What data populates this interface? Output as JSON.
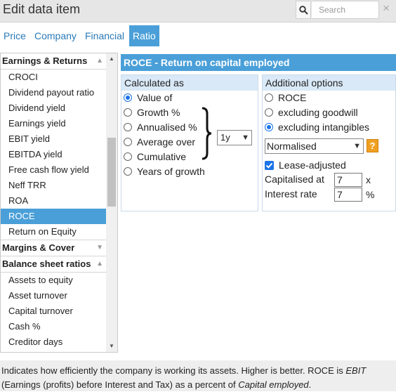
{
  "window": {
    "title": "Edit data item"
  },
  "search": {
    "placeholder": "Search",
    "close": "×"
  },
  "tabs": [
    {
      "label": "Price"
    },
    {
      "label": "Company"
    },
    {
      "label": "Financial"
    },
    {
      "label": "Ratio",
      "active": true
    }
  ],
  "sidebar": {
    "groups": [
      {
        "label": "Earnings & Returns",
        "expanded": true,
        "items": [
          "CROCI",
          "Dividend payout ratio",
          "Dividend yield",
          "Earnings yield",
          "EBIT yield",
          "EBITDA yield",
          "Free cash flow yield",
          "Neff TRR",
          "ROA",
          "ROCE",
          "Return on Equity"
        ],
        "selected": "ROCE"
      },
      {
        "label": "Margins & Cover",
        "expanded": false,
        "items": []
      },
      {
        "label": "Balance sheet ratios",
        "expanded": true,
        "items": [
          "Assets to equity",
          "Asset turnover",
          "Capital turnover",
          "Cash %",
          "Creditor days"
        ]
      }
    ]
  },
  "main": {
    "title": "ROCE - Return on capital employed",
    "calculated_as": {
      "heading": "Calculated as",
      "options": [
        "Value of",
        "Growth %",
        "Annualised %",
        "Average over",
        "Cumulative",
        "Years of growth"
      ],
      "selected": "Value of",
      "period": "1y"
    },
    "additional": {
      "heading": "Additional options",
      "options": [
        "ROCE",
        "excluding goodwill",
        "excluding intangibles"
      ],
      "selected": "excluding intangibles",
      "basis": "Normalised",
      "help": "?",
      "lease_adjusted_label": "Lease-adjusted",
      "lease_adjusted": true,
      "capitalised_label": "Capitalised at",
      "capitalised_value": "7",
      "capitalised_unit": "x",
      "interest_label": "Interest rate",
      "interest_value": "7",
      "interest_unit": "%"
    }
  },
  "footer": {
    "text1": "Indicates how efficiently the company is working its assets. Higher is better. ROCE is ",
    "em1": "EBIT",
    "text2": "(Earnings (profits) before Interest and Tax) as a percent of ",
    "em2": "Capital employed",
    "text3": "."
  },
  "colors": {
    "accent": "#4a9fd8",
    "subheader": "#d9e9f7",
    "help": "#f0a020",
    "link": "#2a7ab8"
  }
}
